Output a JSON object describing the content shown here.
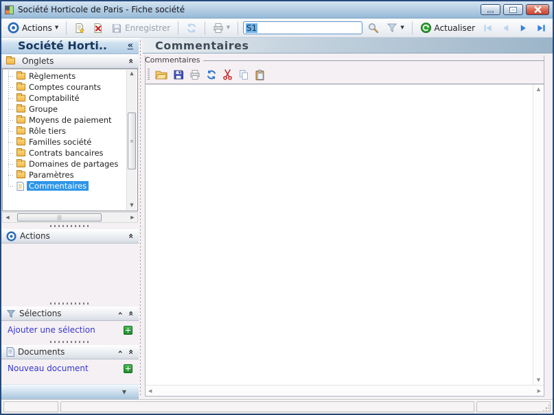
{
  "window": {
    "title": "Société Horticole de Paris -  Fiche société"
  },
  "toolbar": {
    "actions_label": "Actions",
    "enregistrer_label": "Enregistrer",
    "search_value": "S1",
    "actualiser_label": "Actualiser",
    "icons": [
      "actions-bullseye",
      "new-document",
      "delete",
      "save",
      "refresh",
      "print",
      "search-magnifier",
      "filter-funnel",
      "actualiser-refresh",
      "nav-first",
      "nav-previous",
      "nav-next",
      "nav-last"
    ]
  },
  "sidebar": {
    "title": "Société Horti..",
    "onglets": {
      "label": "Onglets"
    },
    "tree": [
      {
        "label": "Règlements",
        "icon": "folder",
        "selected": false
      },
      {
        "label": "Comptes courants",
        "icon": "folder",
        "selected": false
      },
      {
        "label": "Comptabilité",
        "icon": "folder",
        "selected": false
      },
      {
        "label": "Groupe",
        "icon": "folder",
        "selected": false
      },
      {
        "label": "Moyens de paiement",
        "icon": "folder",
        "selected": false
      },
      {
        "label": "Rôle tiers",
        "icon": "folder",
        "selected": false
      },
      {
        "label": "Familles société",
        "icon": "folder",
        "selected": false
      },
      {
        "label": "Contrats bancaires",
        "icon": "folder",
        "selected": false
      },
      {
        "label": "Domaines de partages",
        "icon": "folder",
        "selected": false
      },
      {
        "label": "Paramètres",
        "icon": "folder",
        "selected": false
      },
      {
        "label": "Commentaires",
        "icon": "document",
        "selected": true
      }
    ],
    "actions": {
      "label": "Actions"
    },
    "selections": {
      "label": "Sélections",
      "link": "Ajouter une sélection"
    },
    "documents": {
      "label": "Documents",
      "link": "Nouveau document"
    }
  },
  "main": {
    "title": "Commentaires",
    "group_label": "Commentaires",
    "editor_value": "",
    "editor_toolbar_icons": [
      "open-folder",
      "save",
      "print",
      "refresh",
      "cut",
      "copy",
      "paste"
    ]
  },
  "status_bar": {
    "left": "",
    "middle": "",
    "right": ""
  },
  "colors": {
    "selection_blue": "#2e95e8",
    "link_blue": "#3535cf",
    "accent_green": "#1e8c2a",
    "titlebar_top": "#d4e4f2",
    "titlebar_bottom": "#97bad8",
    "close_red": "#c8402c",
    "panel_pink": "#f5f0f4"
  }
}
